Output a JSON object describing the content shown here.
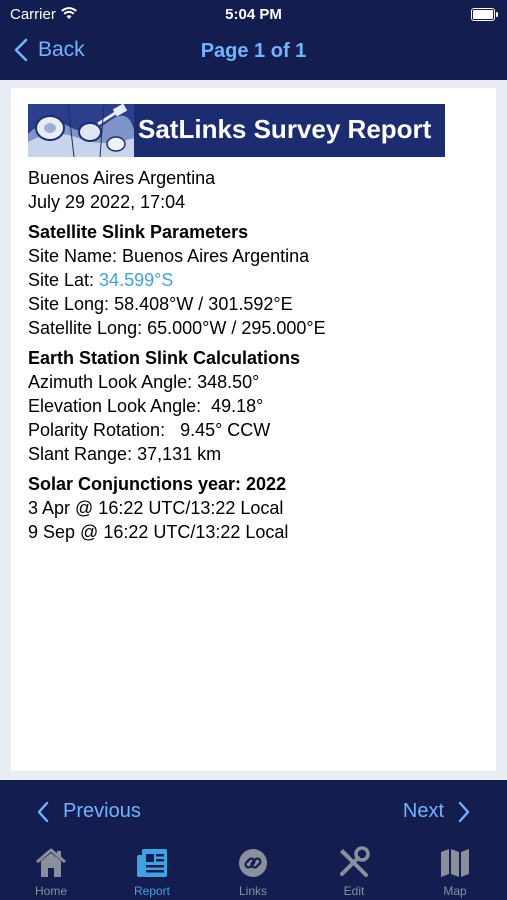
{
  "status": {
    "carrier": "Carrier",
    "time": "5:04 PM"
  },
  "nav": {
    "back_label": "Back",
    "title": "Page 1 of 1"
  },
  "banner": {
    "title": "SatLinks Survey Report"
  },
  "report": {
    "location": "Buenos Aires Argentina",
    "datetime": "July 29 2022, 17:04",
    "params_heading": "Satellite Slink Parameters",
    "site_name": "Site Name: Buenos Aires Argentina",
    "site_lat_label": "Site Lat: ",
    "site_lat_value": "34.599°S",
    "site_long": "Site Long: 58.408°W / 301.592°E",
    "satellite_long": "Satellite Long: 65.000°W / 295.000°E",
    "calc_heading": "Earth Station Slink Calculations",
    "azimuth": "Azimuth Look Angle: 348.50°",
    "elevation": "Elevation Look Angle:  49.18°",
    "polarity": "Polarity Rotation:   9.45° CCW",
    "slant_range": "Slant Range: 37,131 km",
    "solar_heading": "Solar Conjunctions year: 2022",
    "solar_1": "3 Apr @ 16:22 UTC/13:22 Local",
    "solar_2": "9 Sep @ 16:22 UTC/13:22 Local"
  },
  "pager": {
    "previous_label": "Previous",
    "next_label": "Next"
  },
  "tabs": [
    {
      "label": "Home",
      "icon": "home-icon",
      "active": false
    },
    {
      "label": "Report",
      "icon": "report-icon",
      "active": true
    },
    {
      "label": "Links",
      "icon": "links-icon",
      "active": false
    },
    {
      "label": "Edit",
      "icon": "edit-icon",
      "active": false
    },
    {
      "label": "Map",
      "icon": "map-icon",
      "active": false
    }
  ],
  "colors": {
    "navy": "#141d4f",
    "accent": "#6fb4ff",
    "active_tab": "#3fa3e0",
    "inactive_tab": "#8a8f9c"
  }
}
